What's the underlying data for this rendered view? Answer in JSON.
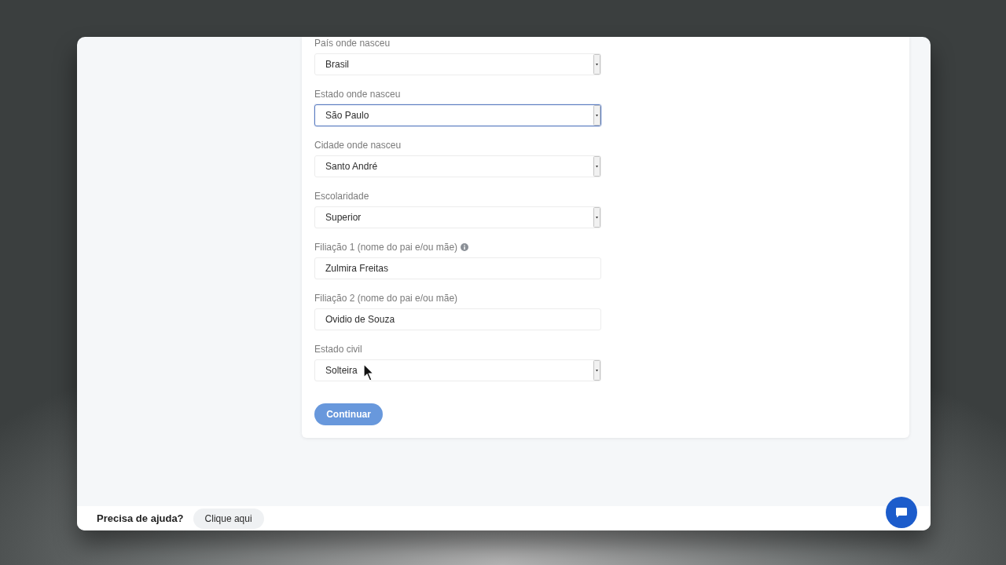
{
  "form": {
    "fields": [
      {
        "label": "País onde nasceu",
        "kind": "select",
        "value": "Brasil",
        "focused": false,
        "info_icon": false
      },
      {
        "label": "Estado onde nasceu",
        "kind": "select",
        "value": "São Paulo",
        "focused": true,
        "info_icon": false
      },
      {
        "label": "Cidade onde nasceu",
        "kind": "select",
        "value": "Santo André",
        "focused": false,
        "info_icon": false
      },
      {
        "label": "Escolaridade",
        "kind": "select",
        "value": "Superior",
        "focused": false,
        "info_icon": false
      },
      {
        "label": "Filiação 1 (nome do pai e/ou mãe)",
        "kind": "text",
        "value": "Zulmira Freitas",
        "focused": false,
        "info_icon": true
      },
      {
        "label": "Filiação 2 (nome do pai e/ou mãe)",
        "kind": "text",
        "value": "Ovidio de Souza",
        "focused": false,
        "info_icon": false
      },
      {
        "label": "Estado civil",
        "kind": "select",
        "value": "Solteira",
        "focused": false,
        "info_icon": false
      }
    ],
    "submit_button": "Continuar"
  },
  "footer": {
    "help_text": "Precisa de ajuda?",
    "help_link": "Clique aqui"
  }
}
